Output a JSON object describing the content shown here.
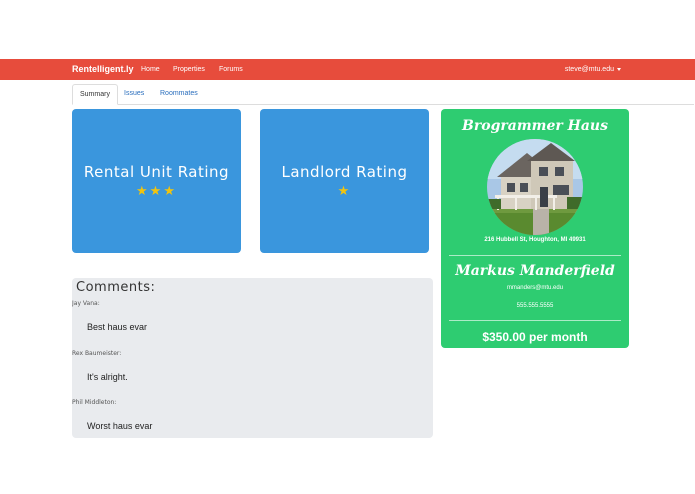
{
  "navbar": {
    "brand": "Rentelligent.ly",
    "links": [
      "Home",
      "Properties",
      "Forums"
    ],
    "user_email": "steve@mtu.edu"
  },
  "tabs": [
    {
      "label": "Summary",
      "active": true
    },
    {
      "label": "Issues",
      "active": false
    },
    {
      "label": "Roommates",
      "active": false
    }
  ],
  "ratings": {
    "rental_unit": {
      "label": "Rental Unit Rating",
      "stars": "★★★",
      "value": 3
    },
    "landlord": {
      "label": "Landlord Rating",
      "stars": "★",
      "value": 1
    }
  },
  "comments": {
    "title": "Comments:",
    "items": [
      {
        "author": "Jay Vana:",
        "text": "Best haus evar"
      },
      {
        "author": "Rex Baumeister:",
        "text": "It's alright."
      },
      {
        "author": "Phil Middleton:",
        "text": "Worst haus evar"
      }
    ]
  },
  "property": {
    "name": "Brogrammer Haus",
    "address": "216 Hubbell St, Houghton, MI 49931",
    "landlord_name": "Markus Manderfield",
    "landlord_email": "mmanders@mtu.edu",
    "landlord_phone": "555.555.5555",
    "price": "$350.00 per month"
  },
  "colors": {
    "navbar": "#e74c3c",
    "rating_card": "#3a96dd",
    "property_card": "#2ecc71",
    "star": "#f1c40f",
    "link": "#2a6ebd"
  }
}
